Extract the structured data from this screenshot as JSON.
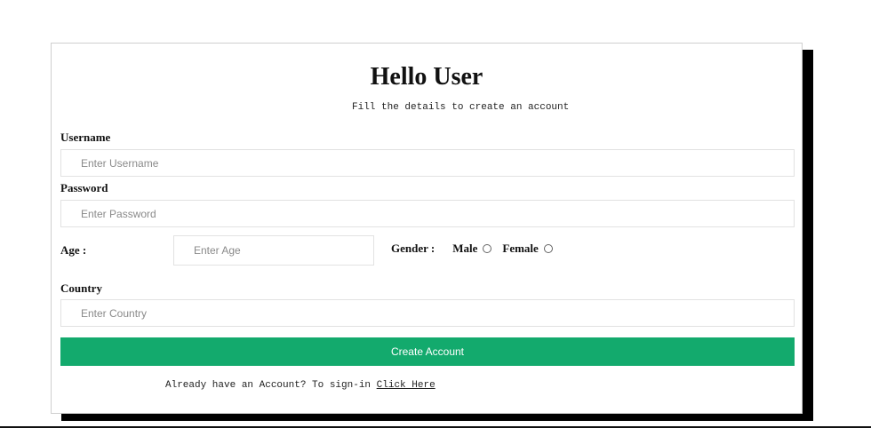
{
  "form": {
    "title": "Hello User",
    "subtitle": "Fill the details to create an account",
    "username": {
      "label": "Username",
      "placeholder": "Enter Username"
    },
    "password": {
      "label": "Password",
      "placeholder": "Enter Password"
    },
    "age": {
      "label": "Age :",
      "placeholder": "Enter Age"
    },
    "gender": {
      "label": "Gender :",
      "options": [
        {
          "label": "Male"
        },
        {
          "label": "Female"
        }
      ]
    },
    "country": {
      "label": "Country",
      "placeholder": "Enter Country"
    },
    "submit_label": "Create Account",
    "signin_text": "Already have an Account? To sign-in",
    "signin_link": "Click Here"
  },
  "colors": {
    "accent": "#13aa6d",
    "shadow": "#000000"
  }
}
